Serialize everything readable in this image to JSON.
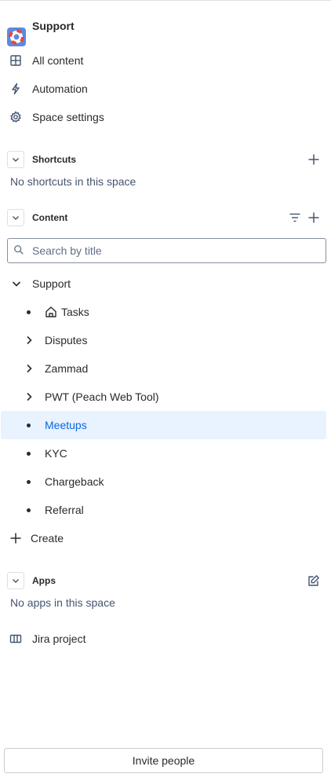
{
  "space": {
    "name": "Support"
  },
  "nav": [
    {
      "label": "All content",
      "icon": "grid-icon"
    },
    {
      "label": "Automation",
      "icon": "lightning-icon"
    },
    {
      "label": "Space settings",
      "icon": "gear-icon"
    }
  ],
  "shortcuts": {
    "title": "Shortcuts",
    "empty": "No shortcuts in this space"
  },
  "content": {
    "title": "Content",
    "search_placeholder": "Search by title",
    "root": "Support",
    "items": [
      {
        "label": "Tasks",
        "kind": "home-bullet"
      },
      {
        "label": "Disputes",
        "kind": "expandable"
      },
      {
        "label": "Zammad",
        "kind": "expandable"
      },
      {
        "label": "PWT (Peach Web Tool)",
        "kind": "expandable"
      },
      {
        "label": "Meetups",
        "kind": "bullet",
        "selected": true
      },
      {
        "label": "KYC",
        "kind": "bullet"
      },
      {
        "label": "Chargeback",
        "kind": "bullet"
      },
      {
        "label": "Referral",
        "kind": "bullet"
      }
    ],
    "create_label": "Create"
  },
  "apps": {
    "title": "Apps",
    "empty": "No apps in this space"
  },
  "jira": {
    "label": "Jira project"
  },
  "invite_label": "Invite people",
  "colors": {
    "accent": "#0c66e4",
    "selected_bg": "#e9f2ff"
  }
}
